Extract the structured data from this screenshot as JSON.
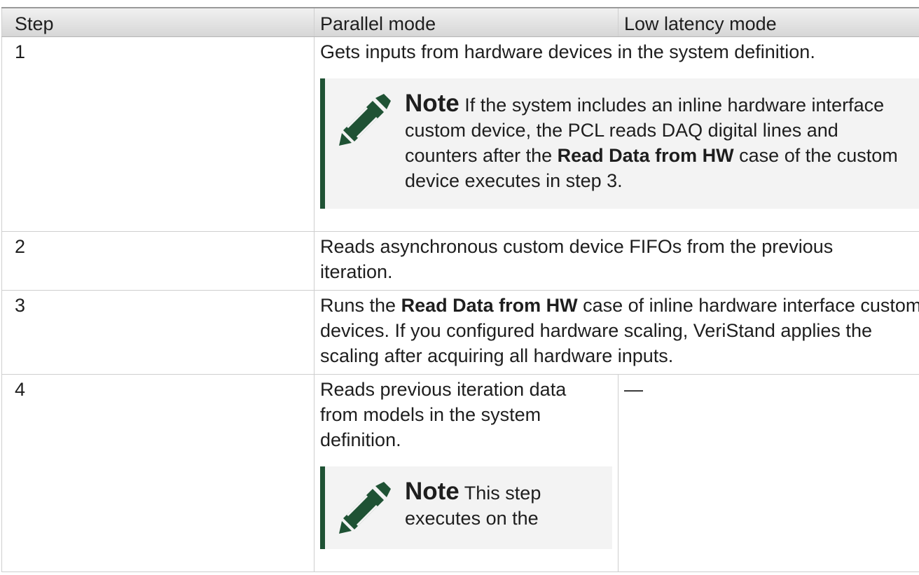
{
  "table": {
    "headers": [
      "Step",
      "Parallel mode",
      "Low latency mode"
    ],
    "rows": [
      {
        "step": "1",
        "text": "Gets inputs from hardware devices in the system definition.",
        "note": {
          "label": "Note",
          "text_before": " If the system includes an inline hardware interface custom device, the PCL reads DAQ digital lines and counters after the ",
          "bold": "Read Data from HW",
          "text_after": " case of the custom device executes in step 3."
        }
      },
      {
        "step": "2",
        "text": "Reads asynchronous custom device FIFOs from the previous iteration."
      },
      {
        "step": "3",
        "text_before": "Runs the ",
        "bold": "Read Data from HW",
        "text_after": " case of inline hardware interface custom devices. If you configured hardware scaling, VeriStand applies the scaling after acquiring all hardware inputs."
      },
      {
        "step": "4",
        "parallel_text": "Reads previous iteration data from models in the system definition.",
        "note": {
          "label": "Note",
          "text": " This step executes on the"
        },
        "low_latency_text": "—"
      }
    ]
  },
  "icons": {
    "note_icon": "pencil-icon",
    "note_accent_color": "#1f5234"
  }
}
